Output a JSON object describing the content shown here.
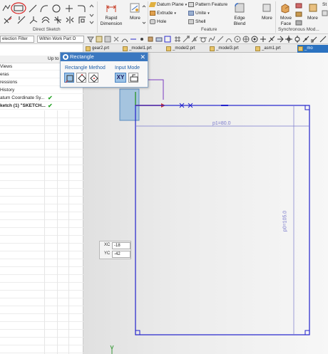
{
  "ribbon": {
    "direct_sketch_label": "Direct Sketch",
    "rapid_dimension_label": "Rapid\nDimension",
    "more_label_1": "More",
    "feature_label": "Feature",
    "datum_plane": "Datum Plane",
    "pattern_feature": "Pattern Feature",
    "extrude": "Extrude",
    "unite": "Unite",
    "hole": "Hole",
    "shell": "Shell",
    "edge_blend": "Edge\nBlend",
    "more_label_2": "More",
    "move_face": "Move\nFace",
    "more_label_3": "More",
    "synchronous_label": "Synchronous Mod...",
    "st_label": "St"
  },
  "filter_bar": {
    "selection_filter": "election Filter",
    "scope": "Within Work Part O"
  },
  "tabs": [
    {
      "label": "gear2.prt"
    },
    {
      "label": "_model1.prt"
    },
    {
      "label": "_model2.prt"
    },
    {
      "label": "_model3.prt"
    },
    {
      "label": "_asm1.prt"
    },
    {
      "label": "_mo"
    }
  ],
  "navigator": {
    "column_header": "Up to",
    "rows": [
      {
        "label": "Views"
      },
      {
        "label": "eras"
      },
      {
        "label": "ressions"
      },
      {
        "label": "History"
      },
      {
        "label": "atum Coordinate Sy..."
      },
      {
        "label": "ketch (1) \"SKETCH..."
      }
    ]
  },
  "rect_dialog": {
    "title": "Rectangle",
    "method_label": "Rectangle Method",
    "input_mode_label": "Input Mode",
    "xy_button": "XY"
  },
  "coords": {
    "xc_label": "XC",
    "xc_value": "-18",
    "yc_label": "YC",
    "yc_value": "-42"
  },
  "sketch": {
    "dim_horizontal": "p1=80.0",
    "dim_vertical": "p0=105.0",
    "sketch_color": "#2222cc",
    "accent_blue": "#3b78c0"
  }
}
